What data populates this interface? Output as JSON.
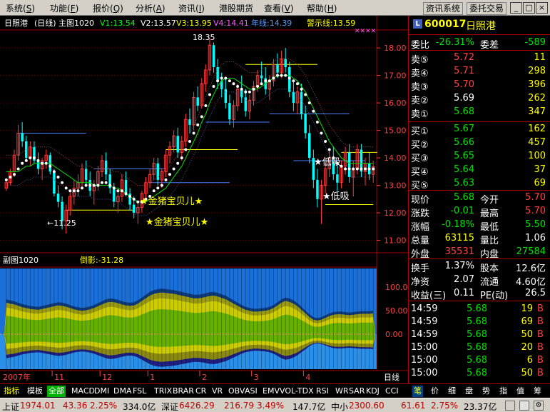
{
  "menu": [
    {
      "label": "系统",
      "key": "S"
    },
    {
      "label": "功能",
      "key": "F"
    },
    {
      "label": "报价",
      "key": "Q"
    },
    {
      "label": "分析",
      "key": "A"
    },
    {
      "label": "资讯",
      "key": "I"
    },
    {
      "label": "港股期货",
      "key": ""
    },
    {
      "label": "查看",
      "key": "V"
    },
    {
      "label": "帮助",
      "key": "H"
    }
  ],
  "top_buttons": {
    "info": "资讯系统",
    "trade": "委托交易"
  },
  "window_buttons": {
    "min": "_",
    "max": "□",
    "close": "×"
  },
  "main_header": {
    "name": "日照港",
    "period": "(日线)",
    "title": "主图1020",
    "v1": "V1:13.54",
    "v2": "V2:13.57",
    "v3": "V3:13.95",
    "v4": "V4:14.41",
    "line": "年线:14.39",
    "warn": "警示线:13.59"
  },
  "annotations": {
    "high": "18.35",
    "low": "←11.25",
    "star1": "★金猪宝贝儿★",
    "star2": "★金猪宝贝儿★",
    "s_high": "★低吸",
    "s_low": "★低吸"
  },
  "sub_header": {
    "title": "副图1020",
    "value": "倒影:-31.28"
  },
  "date_axis": {
    "labels": [
      "2007年",
      "11",
      "12",
      "1",
      "2",
      "3",
      "4"
    ],
    "mode": "日线"
  },
  "colors": {
    "up": "#ff3c3c",
    "down": "#00ffff",
    "green": "#00e000",
    "yellow": "#ffff00",
    "white": "#ffffff",
    "bg": "#000000",
    "grid": "#a00000"
  },
  "chart_data": {
    "type": "candlestick",
    "price_axis": {
      "labels": [
        "18.00",
        "17.00",
        "16.00",
        "15.00",
        "14.00",
        "13.00",
        "12.00",
        "11.00"
      ],
      "values": [
        18,
        17,
        16,
        15,
        14,
        13,
        12,
        11
      ],
      "range": [
        10.6,
        18.6
      ]
    },
    "sub_axis": {
      "labels": [
        "100.0",
        "50.00",
        "0.00"
      ],
      "values": [
        100,
        50,
        0
      ],
      "range": [
        -75,
        140
      ]
    },
    "candles": [
      [
        12.9,
        13.2,
        12.8,
        13.1
      ],
      [
        13.1,
        13.6,
        13.0,
        13.5
      ],
      [
        13.5,
        14.3,
        13.3,
        14.1
      ],
      [
        14.1,
        15.2,
        13.9,
        14.9
      ],
      [
        14.9,
        15.3,
        14.4,
        14.6
      ],
      [
        14.6,
        14.8,
        13.9,
        14.0
      ],
      [
        14.0,
        14.6,
        13.7,
        14.4
      ],
      [
        14.4,
        14.6,
        13.8,
        13.9
      ],
      [
        13.9,
        14.2,
        13.4,
        13.6
      ],
      [
        13.6,
        14.0,
        13.2,
        13.9
      ],
      [
        13.9,
        14.3,
        13.6,
        14.1
      ],
      [
        14.1,
        14.2,
        13.4,
        13.5
      ],
      [
        13.5,
        13.6,
        12.6,
        12.7
      ],
      [
        12.7,
        13.0,
        12.2,
        12.4
      ],
      [
        12.4,
        12.6,
        11.4,
        11.7
      ],
      [
        11.7,
        12.3,
        11.25,
        12.1
      ],
      [
        12.1,
        12.8,
        11.9,
        12.6
      ],
      [
        12.6,
        13.2,
        12.3,
        12.9
      ],
      [
        12.9,
        13.4,
        12.6,
        13.1
      ],
      [
        13.1,
        13.8,
        12.9,
        13.6
      ],
      [
        13.6,
        13.9,
        13.0,
        13.2
      ],
      [
        13.2,
        13.5,
        12.6,
        12.8
      ],
      [
        12.8,
        13.2,
        12.3,
        13.0
      ],
      [
        13.0,
        13.7,
        12.8,
        13.5
      ],
      [
        13.5,
        14.1,
        13.3,
        13.9
      ],
      [
        13.9,
        14.2,
        13.2,
        13.4
      ],
      [
        13.4,
        13.6,
        12.7,
        12.9
      ],
      [
        12.9,
        13.1,
        12.2,
        12.4
      ],
      [
        12.4,
        12.8,
        12.0,
        12.6
      ],
      [
        12.6,
        13.4,
        12.4,
        13.2
      ],
      [
        13.2,
        13.5,
        12.6,
        12.7
      ],
      [
        12.7,
        12.9,
        12.1,
        12.3
      ],
      [
        12.3,
        12.6,
        11.8,
        12.0
      ],
      [
        12.0,
        12.4,
        11.6,
        12.2
      ],
      [
        12.2,
        12.8,
        12.0,
        12.7
      ],
      [
        12.7,
        13.3,
        12.5,
        13.1
      ],
      [
        13.1,
        13.6,
        12.9,
        13.4
      ],
      [
        13.4,
        14.0,
        13.2,
        13.8
      ],
      [
        13.8,
        14.0,
        13.0,
        13.2
      ],
      [
        13.2,
        13.6,
        12.9,
        13.5
      ],
      [
        13.5,
        14.3,
        13.3,
        14.1
      ],
      [
        14.1,
        14.6,
        13.8,
        14.4
      ],
      [
        14.4,
        15.0,
        14.2,
        14.8
      ],
      [
        14.8,
        15.1,
        14.0,
        14.2
      ],
      [
        14.2,
        14.8,
        13.9,
        14.6
      ],
      [
        14.6,
        15.6,
        14.4,
        15.4
      ],
      [
        15.4,
        15.8,
        14.9,
        15.2
      ],
      [
        15.2,
        16.4,
        15.0,
        16.2
      ],
      [
        16.2,
        16.6,
        15.7,
        15.9
      ],
      [
        15.9,
        16.9,
        15.8,
        16.7
      ],
      [
        16.7,
        17.4,
        16.4,
        17.2
      ],
      [
        17.2,
        18.35,
        17.0,
        18.1
      ],
      [
        18.1,
        18.2,
        17.1,
        17.3
      ],
      [
        17.3,
        17.6,
        16.5,
        16.8
      ],
      [
        16.8,
        17.1,
        16.2,
        16.5
      ],
      [
        16.5,
        16.9,
        15.8,
        16.0
      ],
      [
        16.0,
        16.3,
        15.2,
        15.4
      ],
      [
        15.4,
        16.1,
        15.1,
        15.9
      ],
      [
        15.9,
        16.7,
        15.7,
        16.5
      ],
      [
        16.5,
        17.0,
        16.0,
        16.2
      ],
      [
        16.2,
        16.5,
        15.5,
        15.7
      ],
      [
        15.7,
        16.3,
        15.4,
        16.1
      ],
      [
        16.1,
        16.8,
        15.9,
        16.6
      ],
      [
        16.6,
        17.2,
        16.4,
        17.0
      ],
      [
        17.0,
        17.5,
        16.7,
        16.9
      ],
      [
        16.9,
        17.3,
        16.3,
        16.5
      ],
      [
        16.5,
        17.0,
        16.1,
        16.8
      ],
      [
        16.8,
        17.6,
        16.6,
        17.4
      ],
      [
        17.4,
        17.8,
        16.9,
        17.1
      ],
      [
        17.1,
        17.9,
        16.9,
        17.6
      ],
      [
        17.6,
        18.0,
        17.1,
        17.3
      ],
      [
        17.3,
        17.5,
        16.2,
        16.4
      ],
      [
        16.4,
        16.8,
        15.7,
        16.0
      ],
      [
        16.0,
        16.6,
        15.6,
        16.4
      ],
      [
        16.4,
        16.7,
        15.4,
        15.6
      ],
      [
        15.6,
        15.9,
        14.7,
        14.9
      ],
      [
        14.9,
        15.2,
        13.8,
        14.0
      ],
      [
        14.0,
        14.3,
        12.9,
        13.2
      ],
      [
        13.2,
        13.6,
        12.2,
        12.5
      ],
      [
        12.5,
        13.2,
        11.6,
        13.0
      ],
      [
        13.0,
        13.8,
        12.7,
        13.6
      ],
      [
        13.6,
        14.3,
        13.3,
        14.0
      ],
      [
        14.0,
        14.4,
        13.2,
        13.4
      ],
      [
        13.4,
        13.8,
        12.8,
        13.1
      ],
      [
        13.1,
        13.9,
        12.9,
        13.7
      ],
      [
        13.7,
        14.4,
        13.4,
        14.2
      ],
      [
        14.2,
        14.5,
        13.1,
        13.3
      ],
      [
        13.3,
        13.9,
        12.6,
        13.6
      ],
      [
        13.6,
        14.5,
        13.4,
        14.3
      ],
      [
        14.3,
        14.5,
        13.3,
        13.5
      ],
      [
        13.5,
        14.0,
        13.0,
        13.8
      ],
      [
        13.8,
        14.2,
        13.2,
        13.4
      ],
      [
        13.4,
        13.9,
        13.1,
        13.68
      ]
    ],
    "ma_white": [
      13.2,
      13.3,
      13.4,
      13.6,
      13.8,
      13.9,
      14.0,
      14.0,
      13.9,
      13.8,
      13.8,
      13.7,
      13.5,
      13.3,
      13.1,
      12.9,
      12.8,
      12.8,
      12.8,
      12.9,
      13.0,
      13.0,
      13.0,
      13.0,
      13.1,
      13.1,
      13.0,
      12.9,
      12.8,
      12.8,
      12.7,
      12.6,
      12.5,
      12.4,
      12.4,
      12.5,
      12.6,
      12.8,
      12.9,
      13.0,
      13.2,
      13.4,
      13.6,
      13.8,
      14.0,
      14.3,
      14.6,
      14.9,
      15.2,
      15.5,
      15.9,
      16.3,
      16.6,
      16.8,
      16.9,
      16.9,
      16.8,
      16.7,
      16.6,
      16.5,
      16.4,
      16.4,
      16.5,
      16.6,
      16.7,
      16.8,
      16.8,
      16.9,
      17.0,
      17.0,
      17.0,
      16.9,
      16.8,
      16.7,
      16.5,
      16.3,
      16.0,
      15.7,
      15.3,
      14.9,
      14.6,
      14.3,
      14.0,
      13.8,
      13.7,
      13.6,
      13.6,
      13.6,
      13.6,
      13.6,
      13.6,
      13.6,
      13.6
    ],
    "ma_green": [
      13.5,
      13.5,
      13.5,
      13.5,
      13.6,
      13.7,
      13.7,
      13.8,
      13.8,
      13.8,
      13.8,
      13.8,
      13.7,
      13.6,
      13.5,
      13.4,
      13.3,
      13.2,
      13.1,
      13.1,
      13.1,
      13.1,
      13.0,
      13.0,
      13.0,
      13.0,
      13.0,
      12.9,
      12.9,
      12.8,
      12.7,
      12.6,
      12.5,
      12.4,
      12.4,
      12.4,
      12.5,
      12.6,
      12.7,
      12.8,
      12.9,
      13.1,
      13.3,
      13.5,
      13.7,
      14.0,
      14.3,
      14.6,
      14.9,
      15.3,
      15.6,
      16.0,
      16.3,
      16.6,
      16.8,
      16.9,
      16.9,
      16.9,
      16.8,
      16.7,
      16.6,
      16.5,
      16.5,
      16.5,
      16.6,
      16.7,
      16.8,
      16.9,
      17.0,
      17.0,
      17.0,
      17.0,
      16.9,
      16.8,
      16.6,
      16.4,
      16.1,
      15.8,
      15.5,
      15.2,
      14.9,
      14.6,
      14.4,
      14.2,
      14.0,
      13.9,
      13.8,
      13.8,
      13.8,
      13.8,
      13.8,
      13.8,
      13.8
    ],
    "sub_series": [
      62,
      60,
      58,
      55,
      52,
      50,
      48,
      47,
      46,
      48,
      50,
      52,
      54,
      56,
      55,
      53,
      50,
      47,
      45,
      44,
      45,
      47,
      50,
      54,
      58,
      62,
      64,
      63,
      61,
      58,
      56,
      55,
      56,
      60,
      66,
      72,
      78,
      82,
      84,
      85,
      84,
      83,
      82,
      80,
      78,
      76,
      74,
      72,
      72,
      73,
      75,
      77,
      78,
      76,
      73,
      70,
      65,
      60,
      55,
      50,
      46,
      44,
      42,
      42,
      43,
      44,
      46,
      50,
      56,
      62,
      66,
      64,
      60,
      54,
      46,
      38,
      30,
      24,
      22,
      24,
      28,
      32,
      35,
      36,
      36,
      35,
      34,
      35,
      36,
      37,
      37,
      37,
      38
    ]
  },
  "quote": {
    "code": "600017",
    "name": "日照港",
    "ratio_label": "委比",
    "ratio": "-26.31%",
    "diff_label": "委差",
    "diff": "-589",
    "sell": [
      {
        "l": "卖⑤",
        "p": "5.72",
        "v": "11"
      },
      {
        "l": "卖④",
        "p": "5.71",
        "v": "298"
      },
      {
        "l": "卖③",
        "p": "5.70",
        "v": "396"
      },
      {
        "l": "卖②",
        "p": "5.69",
        "v": "262"
      },
      {
        "l": "卖①",
        "p": "5.68",
        "v": "347"
      }
    ],
    "buy": [
      {
        "l": "买①",
        "p": "5.67",
        "v": "162"
      },
      {
        "l": "买②",
        "p": "5.66",
        "v": "457"
      },
      {
        "l": "买③",
        "p": "5.65",
        "v": "100"
      },
      {
        "l": "买④",
        "p": "5.64",
        "v": "37"
      },
      {
        "l": "买⑤",
        "p": "5.63",
        "v": "69"
      }
    ],
    "stats": [
      {
        "l1": "现价",
        "v1": "5.68",
        "l2": "今开",
        "v2": "5.70"
      },
      {
        "l1": "涨跌",
        "v1": "-0.01",
        "l2": "最高",
        "v2": "5.70"
      },
      {
        "l1": "涨幅",
        "v1": "-0.18%",
        "l2": "最低",
        "v2": "5.50"
      },
      {
        "l1": "总量",
        "v1": "63115",
        "l2": "量比",
        "v2": "1.06"
      },
      {
        "l1": "外盘",
        "v1": "35531",
        "l2": "内盘",
        "v2": "27584"
      }
    ],
    "stats2": [
      {
        "l1": "换手",
        "v1": "1.37%",
        "l2": "股本",
        "v2": "12.6亿"
      },
      {
        "l1": "净资",
        "v1": "2.07",
        "l2": "流通",
        "v2": "4.60亿"
      },
      {
        "l1": "收益(三)",
        "v1": "0.11",
        "l2": "PE(动)",
        "v2": "26.5"
      }
    ],
    "ticks": [
      {
        "t": "14:59",
        "p": "5.68",
        "v": "19",
        "s": "B"
      },
      {
        "t": "14:59",
        "p": "5.68",
        "v": "69",
        "s": "B"
      },
      {
        "t": "14:59",
        "p": "5.68",
        "v": "50",
        "s": "B"
      },
      {
        "t": "15:00",
        "p": "5.68",
        "v": "20",
        "s": "B"
      },
      {
        "t": "15:00",
        "p": "5.68",
        "v": "6",
        "s": "B"
      },
      {
        "t": "15:00",
        "p": "5.68",
        "v": "50",
        "s": "B"
      }
    ]
  },
  "bottom_tabs": [
    "指标",
    "模板",
    "全部",
    "MACD",
    "DMI",
    "DMA",
    "FSL",
    "TRIX",
    "BRAR",
    "CR",
    "VR",
    "OBV",
    "ASI",
    "EMV",
    "VOL-TDX",
    "RSI",
    "WR",
    "SAR",
    "KDJ",
    "CCI"
  ],
  "right_tabs": [
    "笔",
    "价",
    "细",
    "盘",
    "势",
    "指",
    "值",
    "筹"
  ],
  "status": {
    "sh_label": "上证",
    "sh_val": "1974.01",
    "sh_chg": "43.36",
    "sh_pct": "2.25%",
    "sh_amt": "334.0亿",
    "sz_label": "深证",
    "sz_val": "6426.29",
    "sz_chg": "216.79",
    "sz_pct": "3.49%",
    "sz_amt": "147.7亿",
    "zx_label": "中小",
    "zx_val": "2300.60",
    "zx_chg": "61.61",
    "zx_pct": "2.75%",
    "zx_amt": "23.37亿"
  }
}
